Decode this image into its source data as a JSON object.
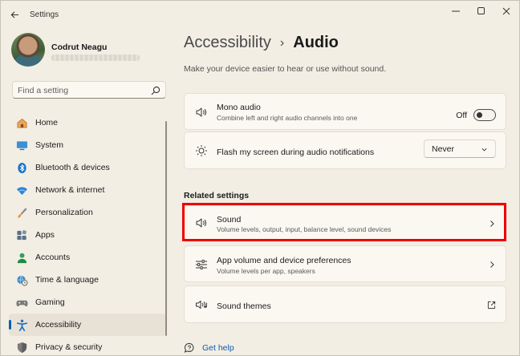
{
  "window": {
    "title": "Settings",
    "controls": [
      "minimize",
      "maximize",
      "close"
    ]
  },
  "profile": {
    "name": "Codrut Neagu"
  },
  "search": {
    "placeholder": "Find a setting"
  },
  "sidebar": {
    "items": [
      {
        "label": "Home",
        "icon": "home-icon",
        "active": false
      },
      {
        "label": "System",
        "icon": "monitor-icon",
        "active": false
      },
      {
        "label": "Bluetooth & devices",
        "icon": "bluetooth-icon",
        "active": false
      },
      {
        "label": "Network & internet",
        "icon": "wifi-icon",
        "active": false
      },
      {
        "label": "Personalization",
        "icon": "brush-icon",
        "active": false
      },
      {
        "label": "Apps",
        "icon": "apps-grid-icon",
        "active": false
      },
      {
        "label": "Accounts",
        "icon": "person-icon",
        "active": false
      },
      {
        "label": "Time & language",
        "icon": "globe-clock-icon",
        "active": false
      },
      {
        "label": "Gaming",
        "icon": "gamepad-icon",
        "active": false
      },
      {
        "label": "Accessibility",
        "icon": "accessibility-icon",
        "active": true
      },
      {
        "label": "Privacy & security",
        "icon": "shield-icon",
        "active": false
      }
    ]
  },
  "main": {
    "breadcrumb_parent": "Accessibility",
    "breadcrumb_separator": "›",
    "page_title": "Audio",
    "subtitle": "Make your device easier to hear or use without sound.",
    "mono_audio": {
      "title": "Mono audio",
      "description": "Combine left and right audio channels into one",
      "toggle_state": "Off",
      "icon": "speaker-icon"
    },
    "flash_screen": {
      "title": "Flash my screen during audio notifications",
      "selected": "Never",
      "icon": "flash-sun-icon"
    },
    "related_title": "Related settings",
    "sound": {
      "title": "Sound",
      "description": "Volume levels, output, input, balance level, sound devices",
      "icon": "speaker-icon"
    },
    "app_volume": {
      "title": "App volume and device preferences",
      "description": "Volume levels per app, speakers",
      "icon": "sliders-icon"
    },
    "sound_themes": {
      "title": "Sound themes",
      "icon": "speaker-music-icon"
    },
    "get_help": "Get help"
  },
  "colors": {
    "accent": "#005fb8",
    "highlight_box": "#ee0000",
    "background": "#f3eee4",
    "card": "#fbf8f2"
  }
}
